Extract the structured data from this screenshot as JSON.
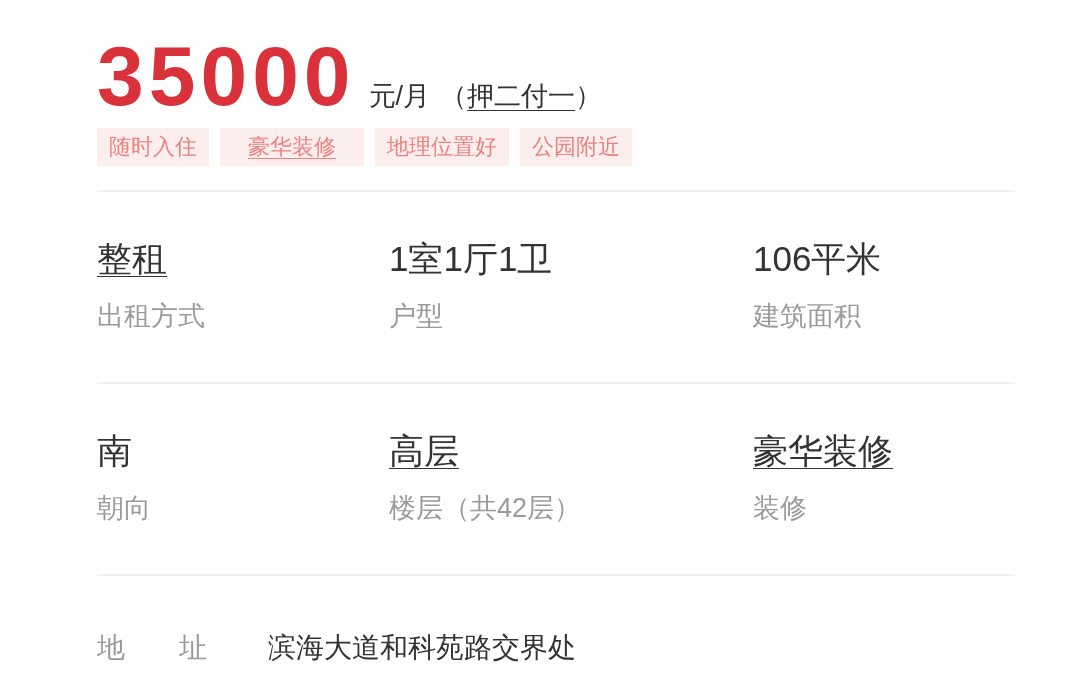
{
  "price": {
    "amount": "35000",
    "unit": "元/月",
    "payment": {
      "prefix": "（",
      "text": "押二付一",
      "suffix": "）",
      "underlined": true
    }
  },
  "tags": [
    {
      "text": "随时入住",
      "underlined": false
    },
    {
      "text": "豪华装修",
      "underlined": true
    },
    {
      "text": "地理位置好",
      "underlined": false
    },
    {
      "text": "公园附近",
      "underlined": false
    }
  ],
  "spec_rows": [
    {
      "items": [
        {
          "value": "整租",
          "label": "出租方式",
          "underlined": true
        },
        {
          "value": "1室1厅1卫",
          "label": "户型",
          "underlined": false
        },
        {
          "value": "106平米",
          "label": "建筑面积",
          "underlined": false
        }
      ]
    },
    {
      "items": [
        {
          "value": "南",
          "label": "朝向",
          "underlined": false
        },
        {
          "value": "高层",
          "label": "楼层（共42层）",
          "underlined": true
        },
        {
          "value": "豪华装修",
          "label": "装修",
          "underlined": true
        }
      ]
    }
  ],
  "address": {
    "label": "地 址",
    "value": "滨海大道和科苑路交界处"
  }
}
